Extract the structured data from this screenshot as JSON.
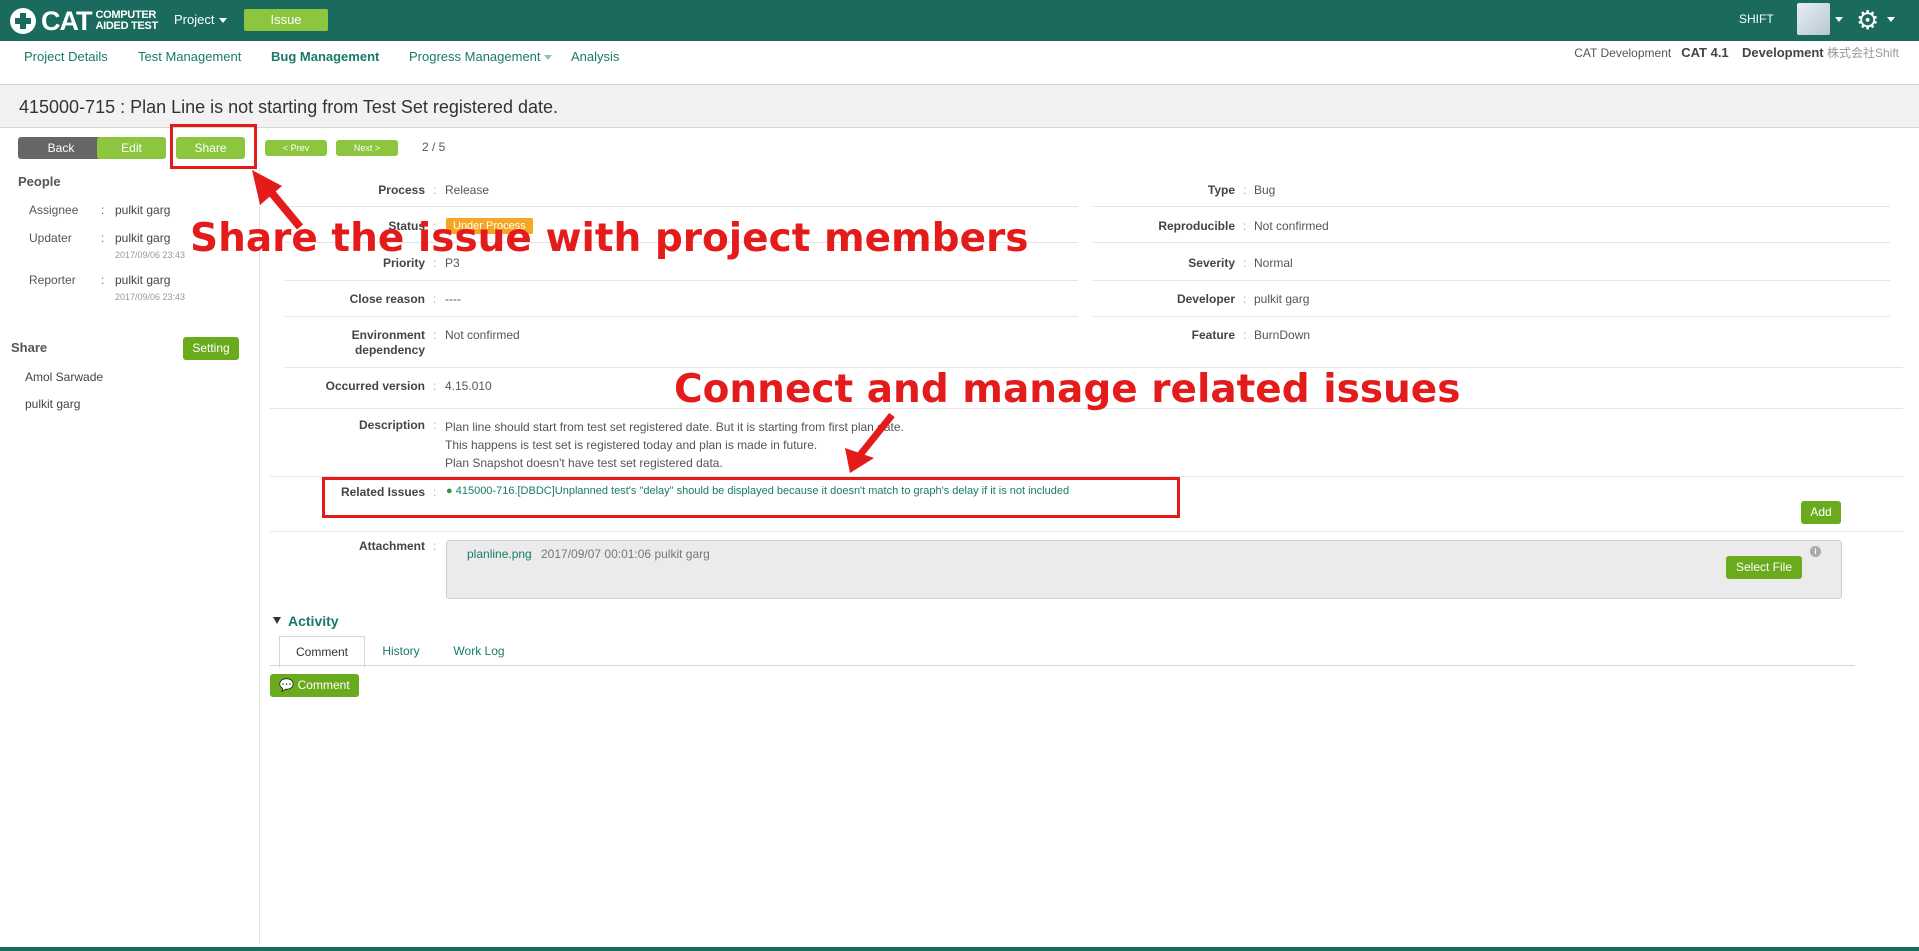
{
  "topbar": {
    "logo_cat": "CAT",
    "logo_sub_line1": "COMPUTER",
    "logo_sub_line2": "AIDED TEST",
    "project_menu": "Project",
    "issue_button": "Issue",
    "user_label": "SHIFT"
  },
  "subnav": {
    "items": [
      "Project Details",
      "Test Management",
      "Bug Management",
      "Progress Management",
      "Analysis"
    ],
    "active": "Bug Management",
    "project_name": "CAT Development",
    "product": "CAT 4.1",
    "phase": "Development",
    "company": "株式会社Shift"
  },
  "issue": {
    "title": "415000-715 :  Plan Line is not starting from Test Set registered date."
  },
  "toolbar": {
    "back": "Back",
    "edit": "Edit",
    "share": "Share",
    "prev": "<  Prev",
    "next": "Next  >",
    "pager": "2 / 5"
  },
  "people": {
    "heading": "People",
    "assignee_label": "Assignee",
    "assignee": "pulkit garg",
    "updater_label": "Updater",
    "updater": "pulkit garg",
    "updater_date": "2017/09/06 23:43",
    "reporter_label": "Reporter",
    "reporter": "pulkit garg",
    "reporter_date": "2017/09/06 23:43"
  },
  "share_panel": {
    "heading": "Share",
    "setting_button": "Setting",
    "members": [
      "Amol Sarwade",
      "pulkit garg"
    ]
  },
  "fields": {
    "process_label": "Process",
    "process": "Release",
    "status_label": "Status",
    "status": "Under Process",
    "priority_label": "Priority",
    "priority": "P3",
    "close_reason_label": "Close reason",
    "close_reason": "----",
    "env_label_1": "Environment",
    "env_label_2": "dependency",
    "env": "Not confirmed",
    "occurred_label": "Occurred version",
    "occurred": "4.15.010",
    "type_label": "Type",
    "type": "Bug",
    "reproducible_label": "Reproducible",
    "reproducible": "Not confirmed",
    "severity_label": "Severity",
    "severity": "Normal",
    "developer_label": "Developer",
    "developer": "pulkit garg",
    "feature_label": "Feature",
    "feature": "BurnDown",
    "description_label": "Description",
    "description_lines": [
      "Plan line should start from test set registered date. But it is starting from first plan date.",
      "This happens is test set is registered today and plan is made in future.",
      "Plan Snapshot doesn't have test set registered data."
    ],
    "related_label": "Related Issues",
    "related_issue": "415000-716.[DBDC]Unplanned test's \"delay\" should be displayed because it doesn't match to graph's delay if it is not included",
    "add_button": "Add",
    "attachment_label": "Attachment",
    "attachment_file": "planline.png",
    "attachment_meta": "2017/09/07 00:01:06 pulkit garg",
    "select_file_button": "Select File"
  },
  "activity": {
    "heading": "Activity",
    "tabs": [
      "Comment",
      "History",
      "Work Log"
    ],
    "comment_button": "Comment"
  },
  "annotations": {
    "share_note": "Share the issue with project members",
    "related_note": "Connect and manage related issues"
  },
  "colors": {
    "header": "#1a6b5e",
    "accent_green": "#8cc63f",
    "status_orange": "#f5a623",
    "annotation_red": "#e31b1b"
  }
}
